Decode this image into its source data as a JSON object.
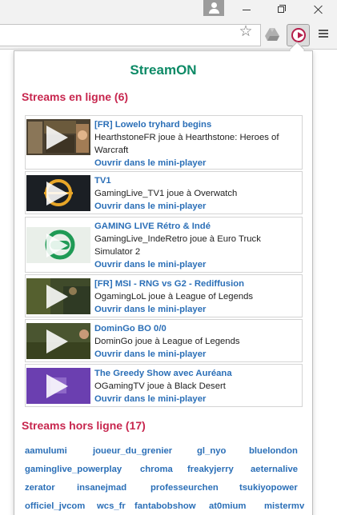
{
  "popup": {
    "title": "StreamON",
    "online_heading": "Streams en ligne (6)",
    "offline_heading": "Streams hors ligne (17)",
    "online_streams": [
      {
        "title": "[FR] Lowelo tryhard begins",
        "subtitle": "HearthstoneFR joue à Hearthstone: Heroes of Warcraft",
        "link": "Ouvrir dans le mini-player"
      },
      {
        "title": "TV1",
        "subtitle": "GamingLive_TV1 joue à Overwatch",
        "link": "Ouvrir dans le mini-player"
      },
      {
        "title": "GAMING LIVE Rétro & Indé",
        "subtitle": "GamingLive_IndeRetro joue à Euro Truck Simulator 2",
        "link": "Ouvrir dans le mini-player"
      },
      {
        "title": "[FR] MSI - RNG vs G2 - Rediffusion",
        "subtitle": "OgamingLoL joue à League of Legends",
        "link": "Ouvrir dans le mini-player"
      },
      {
        "title": "DominGo BO 0/0",
        "subtitle": "DominGo joue à League of Legends",
        "link": "Ouvrir dans le mini-player"
      },
      {
        "title": "The Greedy Show avec Auréana",
        "subtitle": "OGamingTV joue à Black Desert",
        "link": "Ouvrir dans le mini-player"
      }
    ],
    "offline_streams": [
      "aamulumi",
      "joueur_du_grenier",
      "gl_nyo",
      "bluelondon",
      "gaminglive_powerplay",
      "chroma",
      "freakyjerry",
      "aeternalive",
      "zerator",
      "insanejmad",
      "professeurchen",
      "tsukiyopower",
      "officiel_jvcom",
      "wcs_fr",
      "fantabobshow",
      "at0mium",
      "mistermv"
    ]
  },
  "icons": {
    "star": "bookmark-star-icon",
    "drive": "google-drive-icon",
    "extension": "streamon-play-icon",
    "menu": "chrome-menu-icon",
    "user": "user-profile-icon"
  },
  "colors": {
    "title_green": "#0d8a66",
    "heading_red": "#c7264e",
    "link_blue": "#2b6fb7"
  }
}
